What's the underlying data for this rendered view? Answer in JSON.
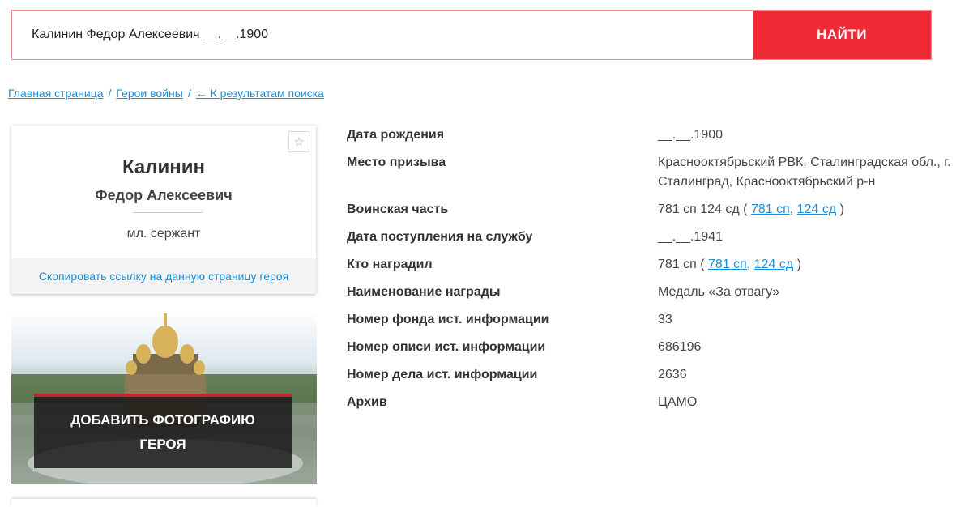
{
  "search": {
    "value": "Калинин Федор Алексеевич __.__.1900",
    "button_label": "НАЙТИ"
  },
  "breadcrumb": {
    "home": "Главная страница",
    "sep1": "/",
    "heroes": "Герои войны",
    "sep2": "/",
    "back": "← К результатам поиска"
  },
  "hero": {
    "surname": "Калинин",
    "names": "Федор Алексеевич",
    "rank": "мл. сержант",
    "copy_link": "Скопировать ссылку на данную страницу героя",
    "favorite_icon": "star-icon"
  },
  "photo": {
    "add_label": "ДОБАВИТЬ ФОТОГРАФИЮ ГЕРОЯ"
  },
  "details": {
    "birth_date": {
      "label": "Дата рождения",
      "value": "__.__.1900"
    },
    "draft_place": {
      "label": "Место призыва",
      "value": "Краснооктябрьский РВК, Сталинградская обл., г. Сталинград, Краснооктябрьский р-н"
    },
    "unit": {
      "label": "Воинская часть",
      "prefix": "781 сп 124 сд (",
      "link1": "781 сп",
      "comma": ",",
      "link2": "124 сд",
      "suffix": ")"
    },
    "service_start": {
      "label": "Дата поступления на службу",
      "value": "__.__.1941"
    },
    "awarded_by": {
      "label": "Кто наградил",
      "prefix": "781 сп (",
      "link1": "781 сп",
      "comma": ",",
      "link2": "124 сд",
      "suffix": ")"
    },
    "award_name": {
      "label": "Наименование награды",
      "value": "Медаль «За отвагу»"
    },
    "fond": {
      "label": "Номер фонда ист. информации",
      "value": "33"
    },
    "opis": {
      "label": "Номер описи ист. информации",
      "value": "686196"
    },
    "delo": {
      "label": "Номер дела ист. информации",
      "value": "2636"
    },
    "archive": {
      "label": "Архив",
      "value": "ЦАМО"
    }
  },
  "colors": {
    "accent_red": "#ee2b36",
    "link_blue": "#1a8ed6"
  }
}
